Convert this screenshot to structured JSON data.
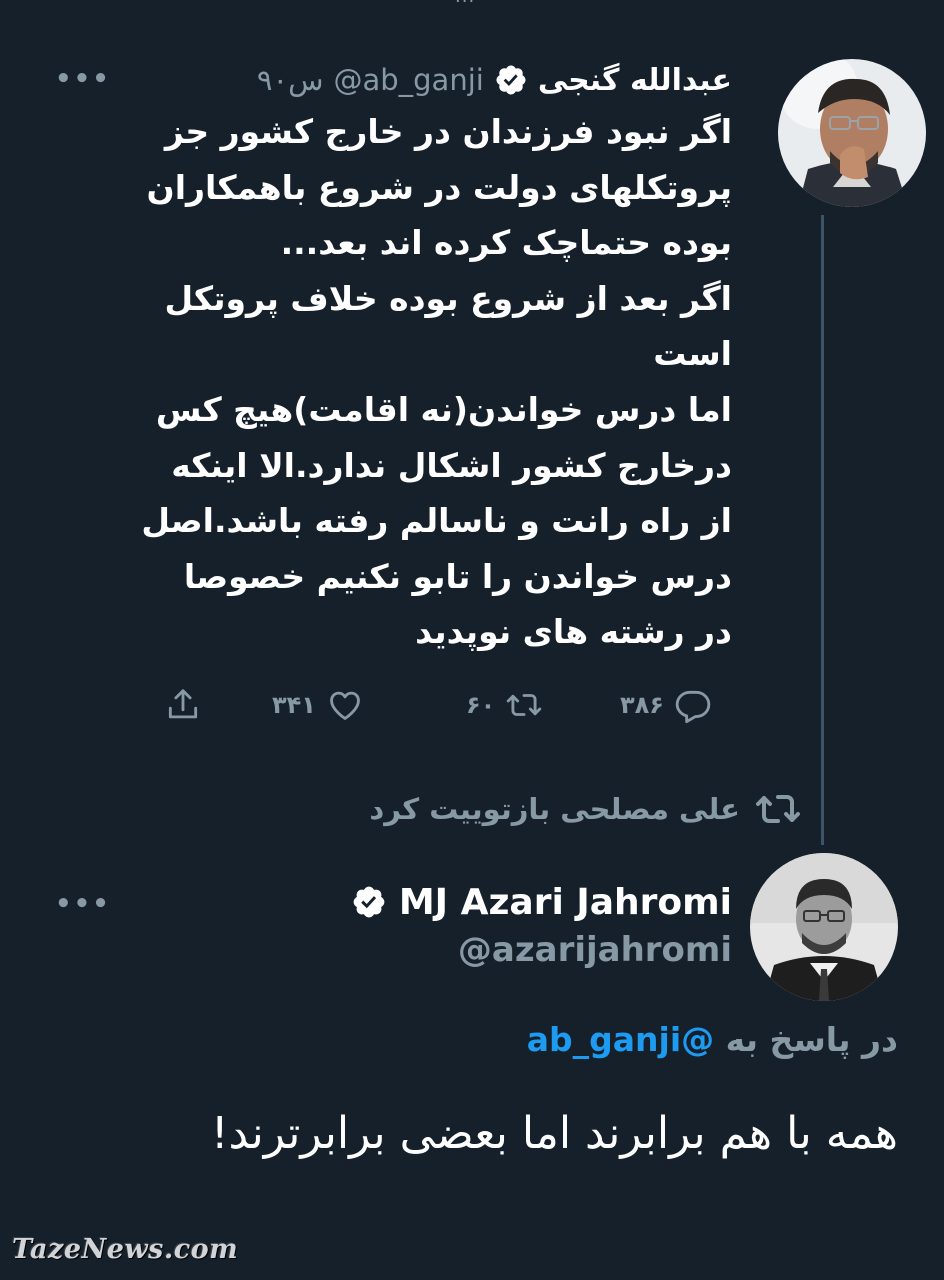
{
  "top_partial_text": "...",
  "tweet1": {
    "author_name": "عبدالله گنجی",
    "handle": "@ab_ganji",
    "time": "۹۰س",
    "text": "اگر نبود فرزندان در خارج کشور جز\nپروتکلهای دولت در شروع باهمکاران\nبوده حتماچک کرده اند بعد...\nاگر بعد از شروع بوده خلاف پروتکل\nاست\nاما درس خواندن(نه اقامت)هیچ کس\nدرخارج کشور اشکال ندارد.الا اینکه\nاز راه رانت و ناسالم رفته باشد.اصل\nدرس خواندن را تابو نکنیم خصوصا\nدر رشته های نوپدید",
    "reply_count": "۳۸۶",
    "retweet_count": "۶۰",
    "like_count": "۳۴۱"
  },
  "retweet_banner": {
    "text": "علی مصلحی بازتوییت کرد",
    "icon": "retweet-icon"
  },
  "tweet2": {
    "author_name": "MJ Azari Jahromi",
    "handle": "@azarijahromi",
    "reply_prefix": "در پاسخ به",
    "reply_mention": "@ab_ganji",
    "text": "همه با هم برابرند اما بعضی برابرترند!"
  },
  "icons": {
    "more": "more-dots-icon",
    "verified": "verified-badge-icon",
    "reply": "reply-icon",
    "retweet": "retweet-icon",
    "like": "heart-icon",
    "share": "share-icon"
  },
  "colors": {
    "background": "#15202b",
    "text": "#ffffff",
    "muted": "#8899a6",
    "link": "#1d9bf0",
    "thread_line": "#3d5466"
  },
  "watermark": "TazeNews.com",
  "more_label": "•••"
}
